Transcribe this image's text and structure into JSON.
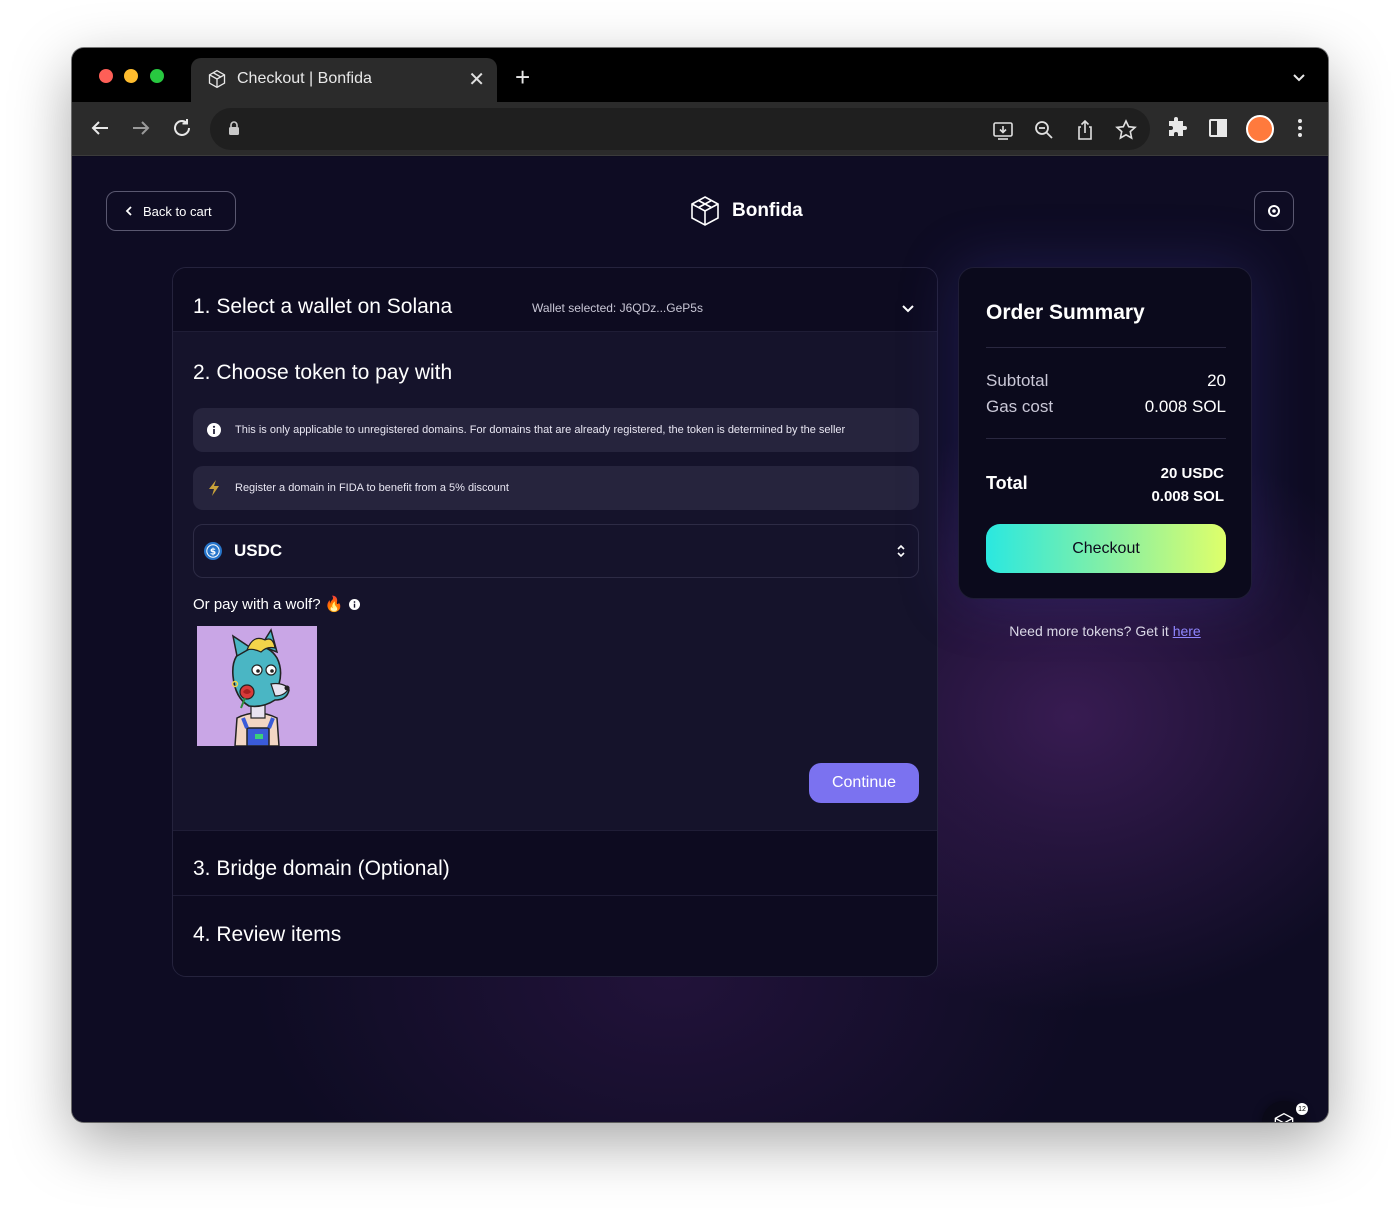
{
  "browser": {
    "tab_title": "Checkout | Bonfida",
    "new_tab_symbol": "+",
    "close_symbol": "✕"
  },
  "header": {
    "back_label": "Back to cart",
    "brand_name": "Bonfida"
  },
  "steps": {
    "step1_title": "1. Select a wallet on Solana",
    "wallet_selected": "Wallet selected: J6QDz...GeP5s",
    "step2_title": "2. Choose token to pay with",
    "info_text": "This is only applicable to unregistered domains. For domains that are already registered, the token is determined by the seller",
    "discount_text": "Register a domain in FIDA to benefit from a 5% discount",
    "token_selected": "USDC",
    "wolf_label": "Or pay with a wolf? 🔥",
    "continue_label": "Continue",
    "step3_title": "3. Bridge domain (Optional)",
    "step4_title": "4. Review items"
  },
  "summary": {
    "title": "Order Summary",
    "subtotal_label": "Subtotal",
    "subtotal_value": "20",
    "gas_label": "Gas cost",
    "gas_value": "0.008 SOL",
    "total_label": "Total",
    "total_usdc": "20 USDC",
    "total_sol": "0.008 SOL",
    "checkout_label": "Checkout"
  },
  "more_tokens": {
    "text": "Need more tokens? Get it ",
    "link": "here"
  },
  "fab": {
    "badge": "12"
  },
  "colors": {
    "accent_purple": "#7b72f0",
    "checkout_gradient_start": "#2ae8e0",
    "checkout_gradient_end": "#dfff6a",
    "page_bg": "#0e0c23"
  }
}
